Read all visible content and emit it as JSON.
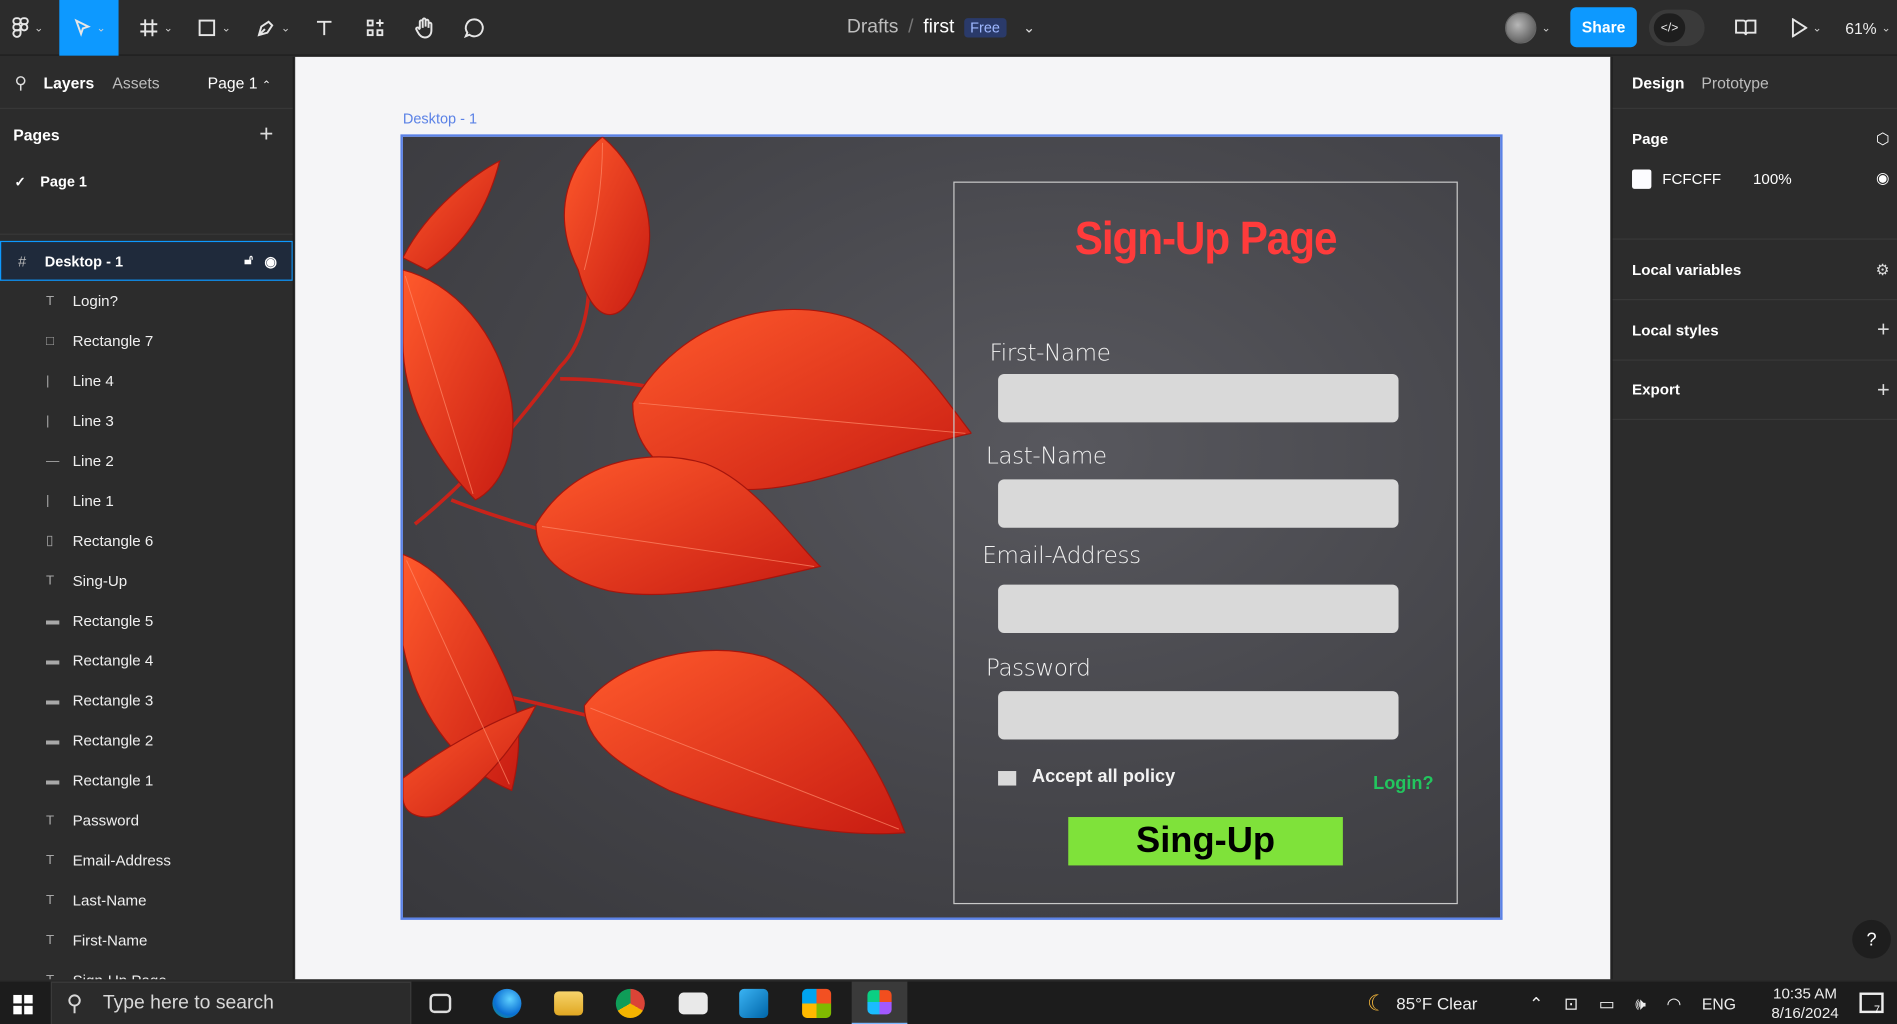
{
  "toolbar": {
    "tools": [
      "figma-menu-icon",
      "move-tool-icon",
      "frame-tool-icon",
      "shape-tool-icon",
      "pen-tool-icon",
      "text-tool-icon",
      "components-icon",
      "hand-tool-icon",
      "comment-icon"
    ],
    "breadcrumb_root": "Drafts",
    "breadcrumb_sep": "/",
    "file_name": "first",
    "plan_badge": "Free",
    "share_label": "Share",
    "zoom": "61%"
  },
  "left": {
    "tab_layers": "Layers",
    "tab_assets": "Assets",
    "page_selector": "Page 1",
    "pages_heading": "Pages",
    "current_page": "Page 1",
    "frame_name": "Desktop - 1",
    "layers": [
      {
        "name": "Login?",
        "icon": "T"
      },
      {
        "name": "Rectangle 7",
        "icon": "□"
      },
      {
        "name": "Line 4",
        "icon": "|"
      },
      {
        "name": "Line 3",
        "icon": "|"
      },
      {
        "name": "Line 2",
        "icon": "—"
      },
      {
        "name": "Line 1",
        "icon": "|"
      },
      {
        "name": "Rectangle 6",
        "icon": "▯"
      },
      {
        "name": "Sing-Up",
        "icon": "T"
      },
      {
        "name": "Rectangle 5",
        "icon": "▬"
      },
      {
        "name": "Rectangle 4",
        "icon": "▬"
      },
      {
        "name": "Rectangle 3",
        "icon": "▬"
      },
      {
        "name": "Rectangle 2",
        "icon": "▬"
      },
      {
        "name": "Rectangle 1",
        "icon": "▬"
      },
      {
        "name": "Password",
        "icon": "T"
      },
      {
        "name": "Email-Address",
        "icon": "T"
      },
      {
        "name": "Last-Name",
        "icon": "T"
      },
      {
        "name": "First-Name",
        "icon": "T"
      },
      {
        "name": "Sign-Up Page",
        "icon": "T"
      }
    ]
  },
  "canvas": {
    "frame_label": "Desktop - 1",
    "title": "Sign-Up Page",
    "first_name": "First-Name",
    "last_name": "Last-Name",
    "email": "Email-Address",
    "password": "Password",
    "accept": "Accept all policy",
    "login": "Login?",
    "button": "Sing-Up"
  },
  "right": {
    "tab_design": "Design",
    "tab_prototype": "Prototype",
    "page_heading": "Page",
    "page_color": "FCFCFF",
    "page_opacity": "100%",
    "local_variables": "Local variables",
    "local_styles": "Local styles",
    "export": "Export"
  },
  "taskbar": {
    "search_placeholder": "Type here to search",
    "weather": "85°F  Clear",
    "lang": "ENG",
    "time": "10:35 AM",
    "date": "8/16/2024",
    "notif": "7"
  }
}
